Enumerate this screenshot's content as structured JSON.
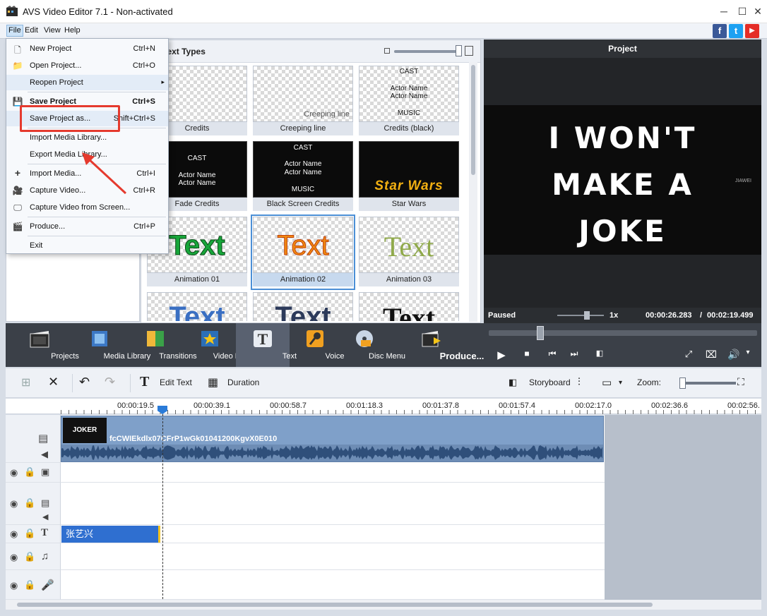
{
  "window": {
    "title": "AVS Video Editor 7.1 - Non-activated",
    "minimize": "─",
    "maximize": "☐",
    "close": "✕"
  },
  "menubar": {
    "file": "File",
    "edit": "Edit",
    "view": "View",
    "help": "Help"
  },
  "social": {
    "facebook": "f",
    "twitter": "t",
    "youtube": "▶"
  },
  "file_menu": {
    "new_project": {
      "label": "New Project",
      "shortcut": "Ctrl+N"
    },
    "open_project": {
      "label": "Open Project...",
      "shortcut": "Ctrl+O"
    },
    "reopen_project": {
      "label": "Reopen Project",
      "shortcut": "▸"
    },
    "save_project": {
      "label": "Save Project",
      "shortcut": "Ctrl+S"
    },
    "save_project_as": {
      "label": "Save Project as...",
      "shortcut": "Shift+Ctrl+S"
    },
    "import_media_library": {
      "label": "Import Media Library..."
    },
    "export_media_library": {
      "label": "Export Media Library..."
    },
    "import_media": {
      "label": "Import Media...",
      "shortcut": "Ctrl+I"
    },
    "capture_video": {
      "label": "Capture Video...",
      "shortcut": "Ctrl+R"
    },
    "capture_video_screen": {
      "label": "Capture Video from Screen..."
    },
    "produce": {
      "label": "Produce...",
      "shortcut": "Ctrl+P"
    },
    "exit": {
      "label": "Exit"
    }
  },
  "effects_panel": {
    "title": "Text Types",
    "tiles": [
      {
        "label": "Credits",
        "style": "checker-credits"
      },
      {
        "label": "Creeping line",
        "overlay": "Creeping line"
      },
      {
        "label": "Credits (black)",
        "lines": [
          "CAST",
          "Actor Name",
          "Actor Name",
          "MUSIC"
        ]
      },
      {
        "label": "Fade Credits",
        "lines": [
          "CAST",
          "Actor Name",
          "Actor Name"
        ]
      },
      {
        "label": "Black Screen Credits",
        "lines": [
          "CAST",
          "Actor Name",
          "Actor Name",
          "MUSIC"
        ]
      },
      {
        "label": "Star Wars",
        "overlay": "Star Wars"
      },
      {
        "label": "Animation 01",
        "overlay": "Text"
      },
      {
        "label": "Animation 02",
        "overlay": "Text"
      },
      {
        "label": "Animation 03",
        "overlay": "Text"
      },
      {
        "label": "",
        "overlay": "Text"
      },
      {
        "label": "",
        "overlay": "Text"
      },
      {
        "label": "",
        "overlay": "Text"
      }
    ]
  },
  "preview": {
    "header": "Project",
    "poster_lines": [
      "I WON'T",
      "MAKE A",
      "JOKE"
    ],
    "watermark": "JIAWEI",
    "status": "Paused",
    "speed": "1x",
    "current_time": "00:00:26.283",
    "total_time": "00:02:19.499",
    "time_separator": "/"
  },
  "main_toolbar": {
    "projects": "Projects",
    "media_library": "Media Library",
    "transitions": "Transitions",
    "video_effects": "Video Effects",
    "text": "Text",
    "voice": "Voice",
    "disc_menu": "Disc Menu",
    "produce": "Produce..."
  },
  "timeline_toolbar": {
    "edit_text": "Edit Text",
    "duration": "Duration",
    "storyboard": "Storyboard",
    "zoom": "Zoom:"
  },
  "ruler": {
    "ticks": [
      "00:00:19.5",
      "00:00:39.1",
      "00:00:58.7",
      "00:01:18.3",
      "00:01:37.8",
      "00:01:57.4",
      "00:02:17.0",
      "00:02:36.6",
      "00:02:56."
    ]
  },
  "tracks": {
    "video_clip_name": "fcCWIEkdlx07CFrP1wGk01041200KgvX0E010",
    "video_thumb_text": "JOKER",
    "text_clip": "张艺兴"
  },
  "colors": {
    "accent": "#2f6fd0",
    "highlight_box": "#e53a2e",
    "toolbar_dark": "#3b4048"
  }
}
